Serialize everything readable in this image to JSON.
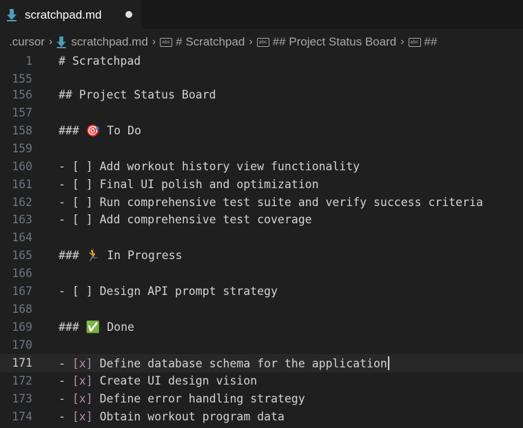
{
  "tab": {
    "filename": "scratchpad.md",
    "icon": "markdown-download-icon",
    "dirty": true
  },
  "breadcrumb": {
    "items": [
      ".cursor",
      "scratchpad.md",
      "# Scratchpad",
      "## Project Status Board",
      "##"
    ]
  },
  "editor": {
    "lines": [
      {
        "num": "1",
        "prefix": "",
        "check": "",
        "text": "# Scratchpad"
      },
      {
        "num": "155",
        "prefix": "",
        "check": "",
        "text": ""
      },
      {
        "num": "156",
        "prefix": "",
        "check": "",
        "text": "## Project Status Board"
      },
      {
        "num": "157",
        "prefix": "",
        "check": "",
        "text": ""
      },
      {
        "num": "158",
        "prefix": "",
        "check": "",
        "text": "### 🎯 To Do"
      },
      {
        "num": "159",
        "prefix": "",
        "check": "",
        "text": ""
      },
      {
        "num": "160",
        "prefix": "- ",
        "check": "[ ]",
        "text": " Add workout history view functionality"
      },
      {
        "num": "161",
        "prefix": "- ",
        "check": "[ ]",
        "text": " Final UI polish and optimization"
      },
      {
        "num": "162",
        "prefix": "- ",
        "check": "[ ]",
        "text": " Run comprehensive test suite and verify success criteria"
      },
      {
        "num": "163",
        "prefix": "- ",
        "check": "[ ]",
        "text": " Add comprehensive test coverage"
      },
      {
        "num": "164",
        "prefix": "",
        "check": "",
        "text": ""
      },
      {
        "num": "165",
        "prefix": "",
        "check": "",
        "text": "### 🏃 In Progress"
      },
      {
        "num": "166",
        "prefix": "",
        "check": "",
        "text": ""
      },
      {
        "num": "167",
        "prefix": "- ",
        "check": "[ ]",
        "text": " Design API prompt strategy"
      },
      {
        "num": "168",
        "prefix": "",
        "check": "",
        "text": ""
      },
      {
        "num": "169",
        "prefix": "",
        "check": "",
        "text": "### ✅ Done"
      },
      {
        "num": "170",
        "prefix": "",
        "check": "",
        "text": ""
      },
      {
        "num": "171",
        "prefix": "- ",
        "check": "[x]",
        "text": " Define database schema for the application",
        "current": true
      },
      {
        "num": "172",
        "prefix": "- ",
        "check": "[x]",
        "text": " Create UI design vision"
      },
      {
        "num": "173",
        "prefix": "- ",
        "check": "[x]",
        "text": " Define error handling strategy"
      },
      {
        "num": "174",
        "prefix": "- ",
        "check": "[x]",
        "text": " Obtain workout program data"
      }
    ]
  },
  "colors": {
    "background": "#1f1f1f",
    "tabbar": "#181818",
    "checkbox": "#b48ead",
    "markdown_icon": "#519aba"
  }
}
